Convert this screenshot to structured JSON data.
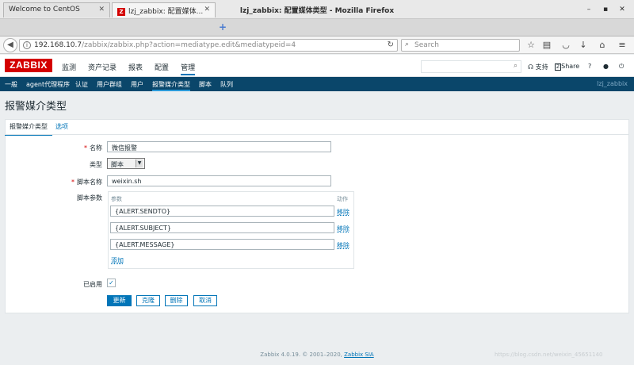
{
  "window": {
    "title": "lzj_zabbix: 配置媒体类型 - Mozilla Firefox"
  },
  "browser": {
    "tabs": [
      {
        "label": "Welcome to CentOS"
      },
      {
        "label": "lzj_zabbix: 配置媒体..."
      }
    ],
    "url_host": "192.168.10.7",
    "url_path": "/zabbix/zabbix.php?action=mediatype.edit&mediatypeid=4",
    "search_placeholder": "Search"
  },
  "zabbix": {
    "logo": "ZABBIX",
    "main_menu": [
      "监测",
      "资产记录",
      "报表",
      "配置",
      "管理"
    ],
    "header_links": {
      "support": "支持",
      "share": "Share",
      "help": "?"
    },
    "sub_menu": [
      "一般",
      "agent代理程序",
      "认证",
      "用户群组",
      "用户",
      "报警媒介类型",
      "脚本",
      "队列"
    ],
    "user": "lzj_zabbix"
  },
  "page": {
    "title": "报警媒介类型",
    "tabs": [
      "报警媒介类型",
      "选项"
    ],
    "form": {
      "name_label": "名称",
      "name_value": "微信报警",
      "type_label": "类型",
      "type_value": "脚本",
      "script_label": "脚本名称",
      "script_value": "weixin.sh",
      "params_label": "脚本参数",
      "params_col_param": "参数",
      "params_col_action": "动作",
      "params": [
        "{ALERT.SENDTO}",
        "{ALERT.SUBJECT}",
        "{ALERT.MESSAGE}"
      ],
      "remove_label": "移除",
      "add_label": "添加",
      "enabled_label": "已启用",
      "enabled_check": "✓"
    },
    "buttons": {
      "update": "更新",
      "clone": "克隆",
      "delete": "删除",
      "cancel": "取消"
    }
  },
  "footer": {
    "text": "Zabbix 4.0.19. © 2001–2020, ",
    "link": "Zabbix SIA",
    "watermark": "https://blog.csdn.net/weixin_45651140"
  },
  "colors": {
    "zabbix_red": "#d40000",
    "nav_blue": "#0a466a",
    "link_blue": "#0275b8"
  }
}
